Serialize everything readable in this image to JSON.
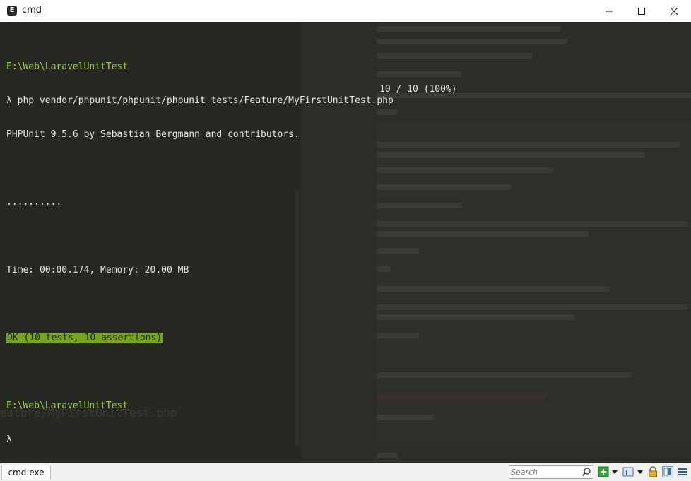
{
  "window": {
    "title": "cmd",
    "app_icon_letter": "E",
    "controls": [
      "minimize-icon",
      "maximize-icon",
      "close-icon"
    ]
  },
  "terminal": {
    "lines": [
      "E:\\Web\\LaravelUnitTest",
      "λ php vendor/phpunit/phpunit/phpunit tests/Feature/MyFirstUnitTest.php",
      "PHPUnit 9.5.6 by Sebastian Bergmann and contributors.",
      "",
      "..........",
      "",
      "Time: 00:00.174, Memory: 20.00 MB",
      "",
      "OK (10 tests, 10 assertions)",
      "",
      "E:\\Web\\LaravelUnitTest",
      "λ"
    ],
    "progress_text": "10 / 10 (100%)",
    "ghost_text": "eature/MyFirstUnitTest.php"
  },
  "statusbar": {
    "tab_label": "cmd.exe",
    "search_placeholder": "Search",
    "icons": [
      "new-console-icon",
      "dropdown-arrow-icon",
      "console-settings-icon",
      "dropdown-arrow-icon",
      "lock-icon",
      "split-view-icon",
      "menu-list-icon"
    ]
  },
  "colors": {
    "terminal_bg": "#272822",
    "prompt_green": "#9bd147",
    "ok_highlight": "#78a41a"
  }
}
